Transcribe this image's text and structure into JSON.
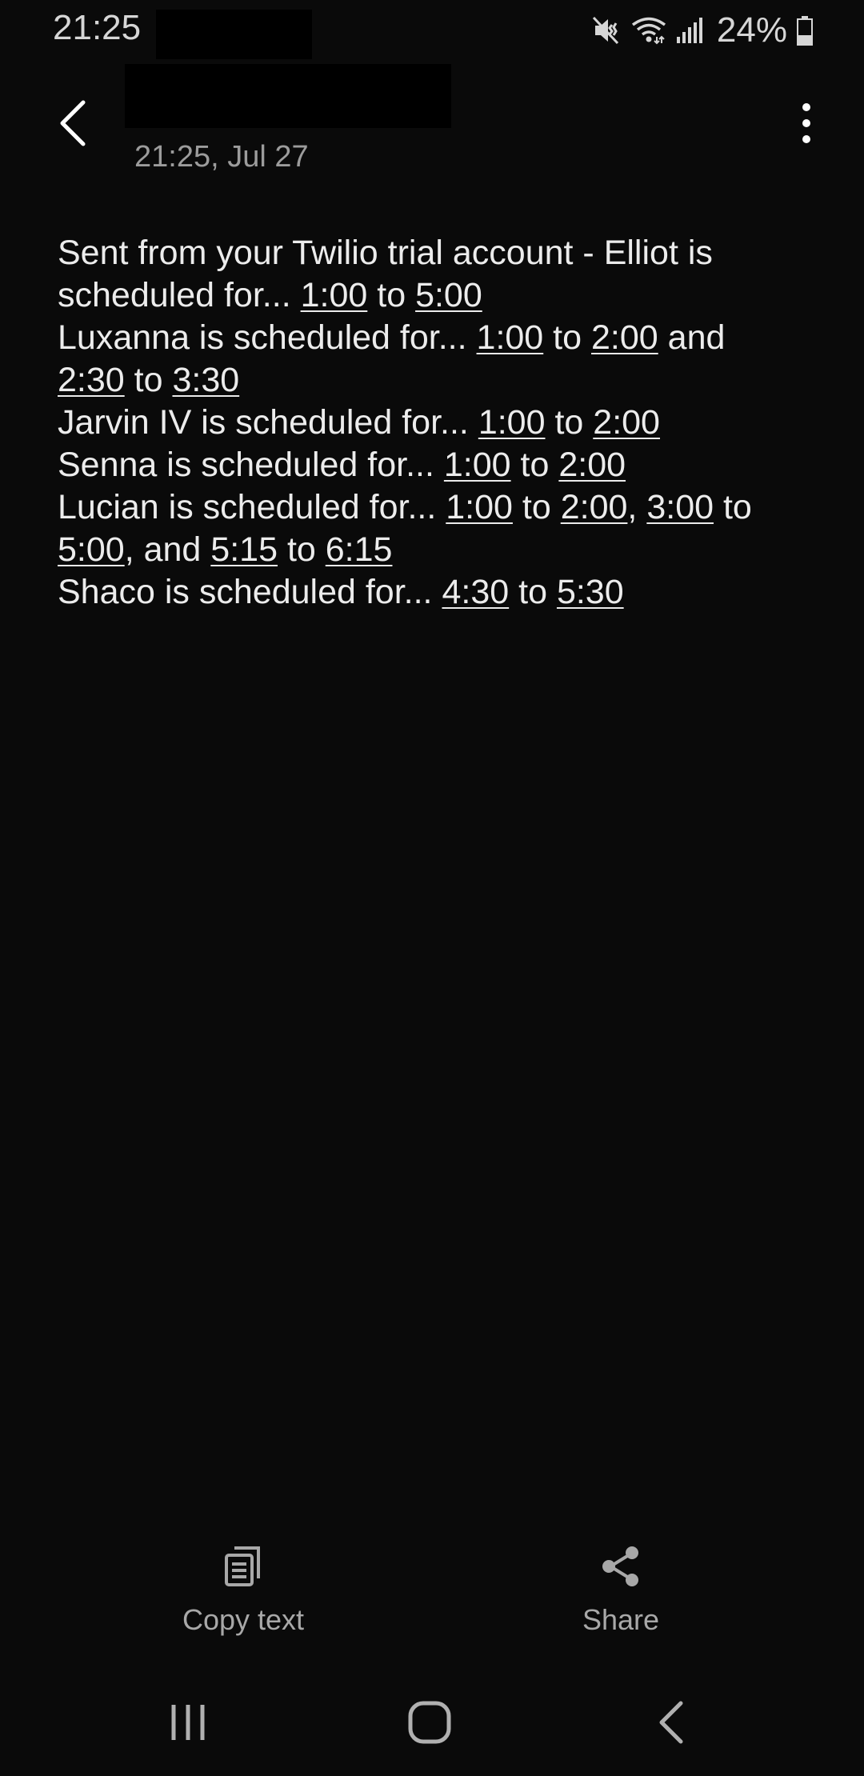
{
  "status_bar": {
    "time": "21:25",
    "battery": "24%",
    "icons": [
      "mute-icon",
      "wifi-icon",
      "signal-icon",
      "battery-icon"
    ]
  },
  "header": {
    "date": "21:25, Jul 27",
    "back_icon": "chevron-left-icon",
    "menu_icon": "more-vertical-icon"
  },
  "message": {
    "lines": [
      [
        {
          "t": "Sent from your Twilio trial account - Elliot is"
        }
      ],
      [
        {
          "t": "scheduled for... "
        },
        {
          "t": "1:00",
          "link": true
        },
        {
          "t": " to "
        },
        {
          "t": "5:00",
          "link": true
        }
      ],
      [
        {
          "t": "Luxanna is scheduled for... "
        },
        {
          "t": "1:00",
          "link": true
        },
        {
          "t": " to "
        },
        {
          "t": "2:00",
          "link": true
        },
        {
          "t": " and"
        }
      ],
      [
        {
          "t": "2:30",
          "link": true
        },
        {
          "t": " to "
        },
        {
          "t": "3:30",
          "link": true
        }
      ],
      [
        {
          "t": "Jarvin IV is scheduled for... "
        },
        {
          "t": "1:00",
          "link": true
        },
        {
          "t": " to "
        },
        {
          "t": "2:00",
          "link": true
        }
      ],
      [
        {
          "t": "Senna is scheduled for... "
        },
        {
          "t": "1:00",
          "link": true
        },
        {
          "t": " to "
        },
        {
          "t": "2:00",
          "link": true
        }
      ],
      [
        {
          "t": "Lucian is scheduled for... "
        },
        {
          "t": "1:00",
          "link": true
        },
        {
          "t": " to "
        },
        {
          "t": "2:00",
          "link": true
        },
        {
          "t": ", "
        },
        {
          "t": "3:00",
          "link": true
        },
        {
          "t": " to"
        }
      ],
      [
        {
          "t": "5:00",
          "link": true
        },
        {
          "t": ", and "
        },
        {
          "t": "5:15",
          "link": true
        },
        {
          "t": " to "
        },
        {
          "t": "6:15",
          "link": true
        }
      ],
      [
        {
          "t": "Shaco is scheduled for... "
        },
        {
          "t": "4:30",
          "link": true
        },
        {
          "t": " to "
        },
        {
          "t": "5:30",
          "link": true
        }
      ]
    ]
  },
  "actions": {
    "copy_text": "Copy text",
    "share": "Share"
  },
  "nav": {
    "icons": [
      "recents-icon",
      "home-icon",
      "back-icon"
    ]
  },
  "colors": {
    "background": "#0a0a0a",
    "text": "#ececec",
    "secondary_text": "#9c9c9c"
  }
}
